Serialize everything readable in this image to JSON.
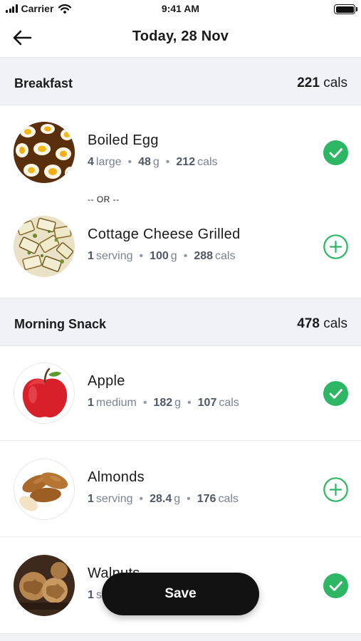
{
  "status_bar": {
    "carrier": "Carrier",
    "time": "9:41 AM"
  },
  "header": {
    "title": "Today, 28 Nov"
  },
  "sections": [
    {
      "name": "Breakfast",
      "calories": "221",
      "unit": "cals",
      "items": [
        {
          "name": "Boiled Egg",
          "qty_num": "4",
          "qty_unit": "large",
          "weight_num": "48",
          "weight_unit": "g",
          "cal_num": "212",
          "cal_unit": "cals",
          "status": "checked"
        },
        {
          "name": "Cottage Cheese Grilled",
          "qty_num": "1",
          "qty_unit": "serving",
          "weight_num": "100",
          "weight_unit": "g",
          "cal_num": "288",
          "cal_unit": "cals",
          "status": "add"
        }
      ],
      "separator": "-- OR --"
    },
    {
      "name": "Morning Snack",
      "calories": "478",
      "unit": "cals",
      "items": [
        {
          "name": "Apple",
          "qty_num": "1",
          "qty_unit": "medium",
          "weight_num": "182",
          "weight_unit": "g",
          "cal_num": "107",
          "cal_unit": "cals",
          "status": "checked"
        },
        {
          "name": "Almonds",
          "qty_num": "1",
          "qty_unit": "serving",
          "weight_num": "28.4",
          "weight_unit": "g",
          "cal_num": "176",
          "cal_unit": "cals",
          "status": "add"
        },
        {
          "name": "Walnuts",
          "qty_num": "1",
          "qty_unit": "s",
          "status": "checked"
        }
      ]
    }
  ],
  "save_label": "Save",
  "colors": {
    "accent_green": "#2db664",
    "text_dark": "#1b1b1b",
    "meta_gray": "#7a8391",
    "section_bg": "#f0f2f5"
  },
  "icons": [
    "back-arrow-icon",
    "check-circle-icon",
    "add-circle-icon",
    "wifi-icon",
    "signal-icon",
    "battery-icon"
  ]
}
